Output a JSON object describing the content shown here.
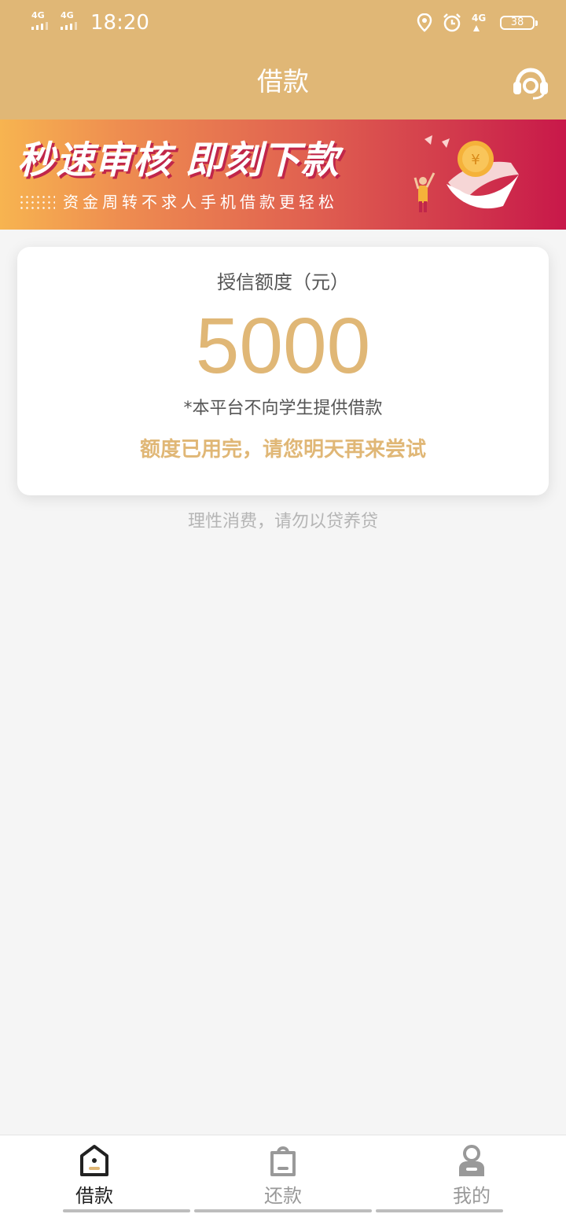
{
  "status_bar": {
    "signal1": "4G",
    "signal2": "4G",
    "time": "18:20",
    "network": "4G",
    "battery": "38",
    "icons": [
      "location-icon",
      "alarm-icon",
      "network-4g-icon",
      "battery-icon"
    ]
  },
  "header": {
    "title": "借款",
    "action_icon": "customer-service-headset-icon"
  },
  "banner": {
    "title": "秒速审核 即刻下款",
    "subtitle": "资金周转不求人手机借款更轻松"
  },
  "credit_card": {
    "label": "授信额度（元）",
    "amount": "5000",
    "note": "*本平台不向学生提供借款",
    "warning": "额度已用完，请您明天再来尝试"
  },
  "hint": "理性消费，请勿以贷养贷",
  "tabbar": {
    "tabs": [
      {
        "label": "借款",
        "icon": "borrow-icon",
        "active": true
      },
      {
        "label": "还款",
        "icon": "repay-icon",
        "active": false
      },
      {
        "label": "我的",
        "icon": "profile-icon",
        "active": false
      }
    ]
  },
  "colors": {
    "brand": "#e0b776",
    "background": "#f5f5f5",
    "banner_start": "#f7b450",
    "banner_end": "#c8184a"
  }
}
